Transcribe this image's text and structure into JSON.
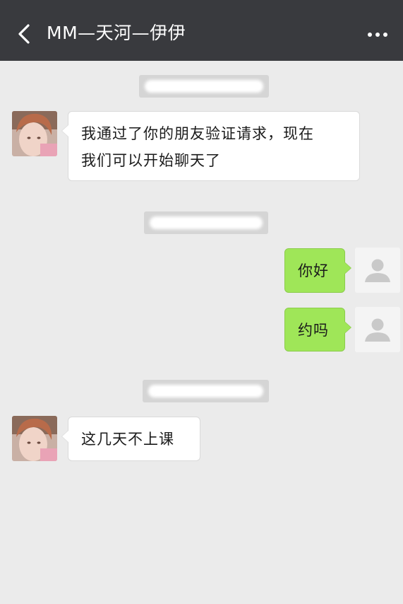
{
  "header": {
    "title": "MM—天河—伊伊",
    "back_icon": "chevron-left-icon",
    "more_icon": "more-dots-icon",
    "background": "#393a3e"
  },
  "messages": [
    {
      "side": "left",
      "sender": "contact",
      "text_lines": [
        "我通过了你的朋友验证请求，现在",
        "我们可以开始聊天了"
      ]
    },
    {
      "side": "right",
      "sender": "me",
      "text": "你好"
    },
    {
      "side": "right",
      "sender": "me",
      "text": "约吗"
    },
    {
      "side": "left",
      "sender": "contact",
      "text": "这几天不上课"
    }
  ],
  "colors": {
    "chat_background": "#ebebeb",
    "outgoing_bubble": "#9fe658",
    "incoming_bubble": "#ffffff"
  }
}
